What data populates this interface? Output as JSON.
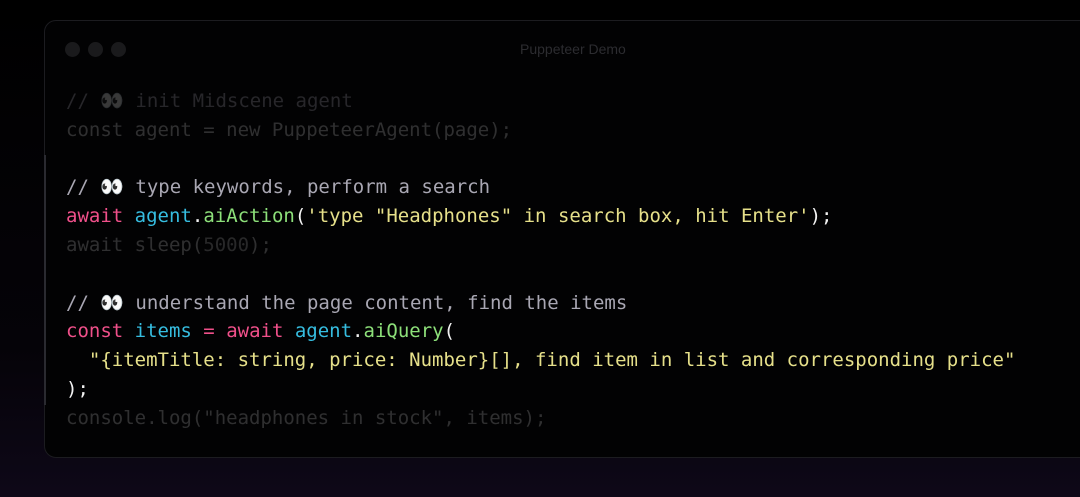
{
  "window": {
    "title": "Puppeteer Demo"
  },
  "code": {
    "lines": [
      {
        "dim": true,
        "tokens": [
          {
            "t": "// 👀 init Midscene agent",
            "c": "comment"
          }
        ]
      },
      {
        "dim": true,
        "tokens": [
          {
            "t": "const agent = new PuppeteerAgent(page);",
            "c": "plain"
          }
        ]
      },
      {
        "dim": false,
        "tokens": []
      },
      {
        "dim": false,
        "tokens": [
          {
            "t": "// 👀 type keywords, perform a search",
            "c": "comment"
          }
        ]
      },
      {
        "dim": false,
        "tokens": [
          {
            "t": "await",
            "c": "kw"
          },
          {
            "t": " ",
            "c": "plain"
          },
          {
            "t": "agent",
            "c": "var"
          },
          {
            "t": ".",
            "c": "punc"
          },
          {
            "t": "aiAction",
            "c": "fn"
          },
          {
            "t": "(",
            "c": "punc"
          },
          {
            "t": "'type \"Headphones\" in search box, hit Enter'",
            "c": "str"
          },
          {
            "t": ");",
            "c": "punc"
          }
        ]
      },
      {
        "dim": true,
        "tokens": [
          {
            "t": "await sleep(",
            "c": "plain"
          },
          {
            "t": "5000",
            "c": "num"
          },
          {
            "t": ");",
            "c": "plain"
          }
        ]
      },
      {
        "dim": false,
        "tokens": []
      },
      {
        "dim": false,
        "tokens": [
          {
            "t": "// 👀 understand the page content, find the items",
            "c": "comment"
          }
        ]
      },
      {
        "dim": false,
        "tokens": [
          {
            "t": "const",
            "c": "kw"
          },
          {
            "t": " ",
            "c": "plain"
          },
          {
            "t": "items",
            "c": "var"
          },
          {
            "t": " = ",
            "c": "kw"
          },
          {
            "t": "await",
            "c": "kw"
          },
          {
            "t": " ",
            "c": "plain"
          },
          {
            "t": "agent",
            "c": "var"
          },
          {
            "t": ".",
            "c": "punc"
          },
          {
            "t": "aiQuery",
            "c": "fn"
          },
          {
            "t": "(",
            "c": "punc"
          }
        ]
      },
      {
        "dim": false,
        "tokens": [
          {
            "t": "  \"{itemTitle: string, price: Number}[], find item in list and corresponding price\"",
            "c": "str"
          }
        ]
      },
      {
        "dim": false,
        "tokens": [
          {
            "t": ");",
            "c": "punc"
          }
        ]
      },
      {
        "dim": true,
        "tokens": [
          {
            "t": "console.log(\"headphones in stock\", items);",
            "c": "plain"
          }
        ]
      }
    ]
  }
}
